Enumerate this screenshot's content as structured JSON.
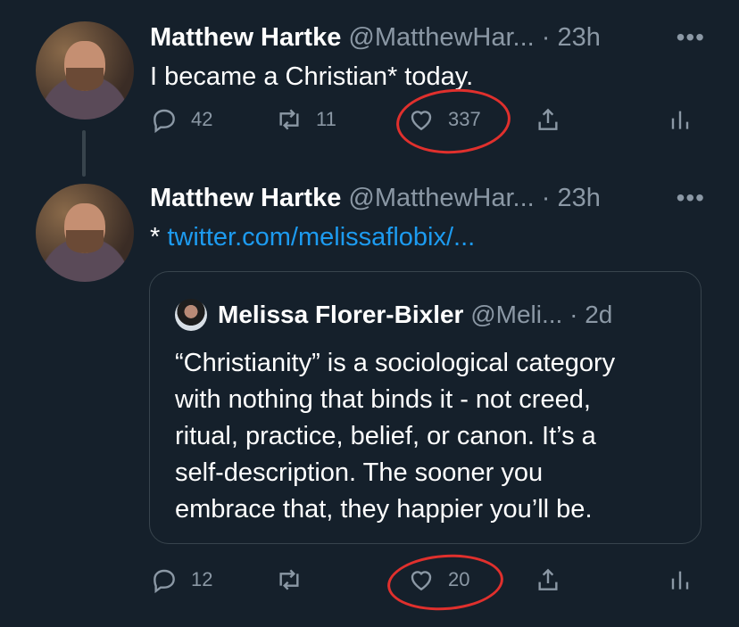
{
  "tweets": [
    {
      "name": "Matthew Hartke",
      "handle": "@MatthewHar...",
      "time": "· 23h",
      "more": "•••",
      "text": "I became a Christian* today.",
      "replies": "42",
      "retweets": "11",
      "likes": "337",
      "share": "",
      "analytics": ""
    },
    {
      "name": "Matthew Hartke",
      "handle": "@MatthewHar...",
      "time": "· 23h",
      "more": "•••",
      "text_prefix": "* ",
      "link": "twitter.com/melissaflobix/...",
      "replies": "12",
      "retweets": "",
      "likes": "20"
    }
  ],
  "quote": {
    "name": "Melissa Florer-Bixler",
    "handle": "@Meli...",
    "time": "· 2d",
    "lines": [
      "“Christianity” is a sociological category",
      "with nothing that binds it - not creed,",
      "ritual, practice, belief, or canon. It’s a",
      "self-description. The sooner you",
      "embrace that, they happier you’ll be."
    ]
  },
  "icons": [
    "reply-icon",
    "retweet-icon",
    "like-icon",
    "share-icon",
    "analytics-icon"
  ],
  "colors": {
    "background": "#15202b",
    "link": "#1d9bf0",
    "muted": "#8b98a5",
    "annotation": "#e0302d"
  }
}
